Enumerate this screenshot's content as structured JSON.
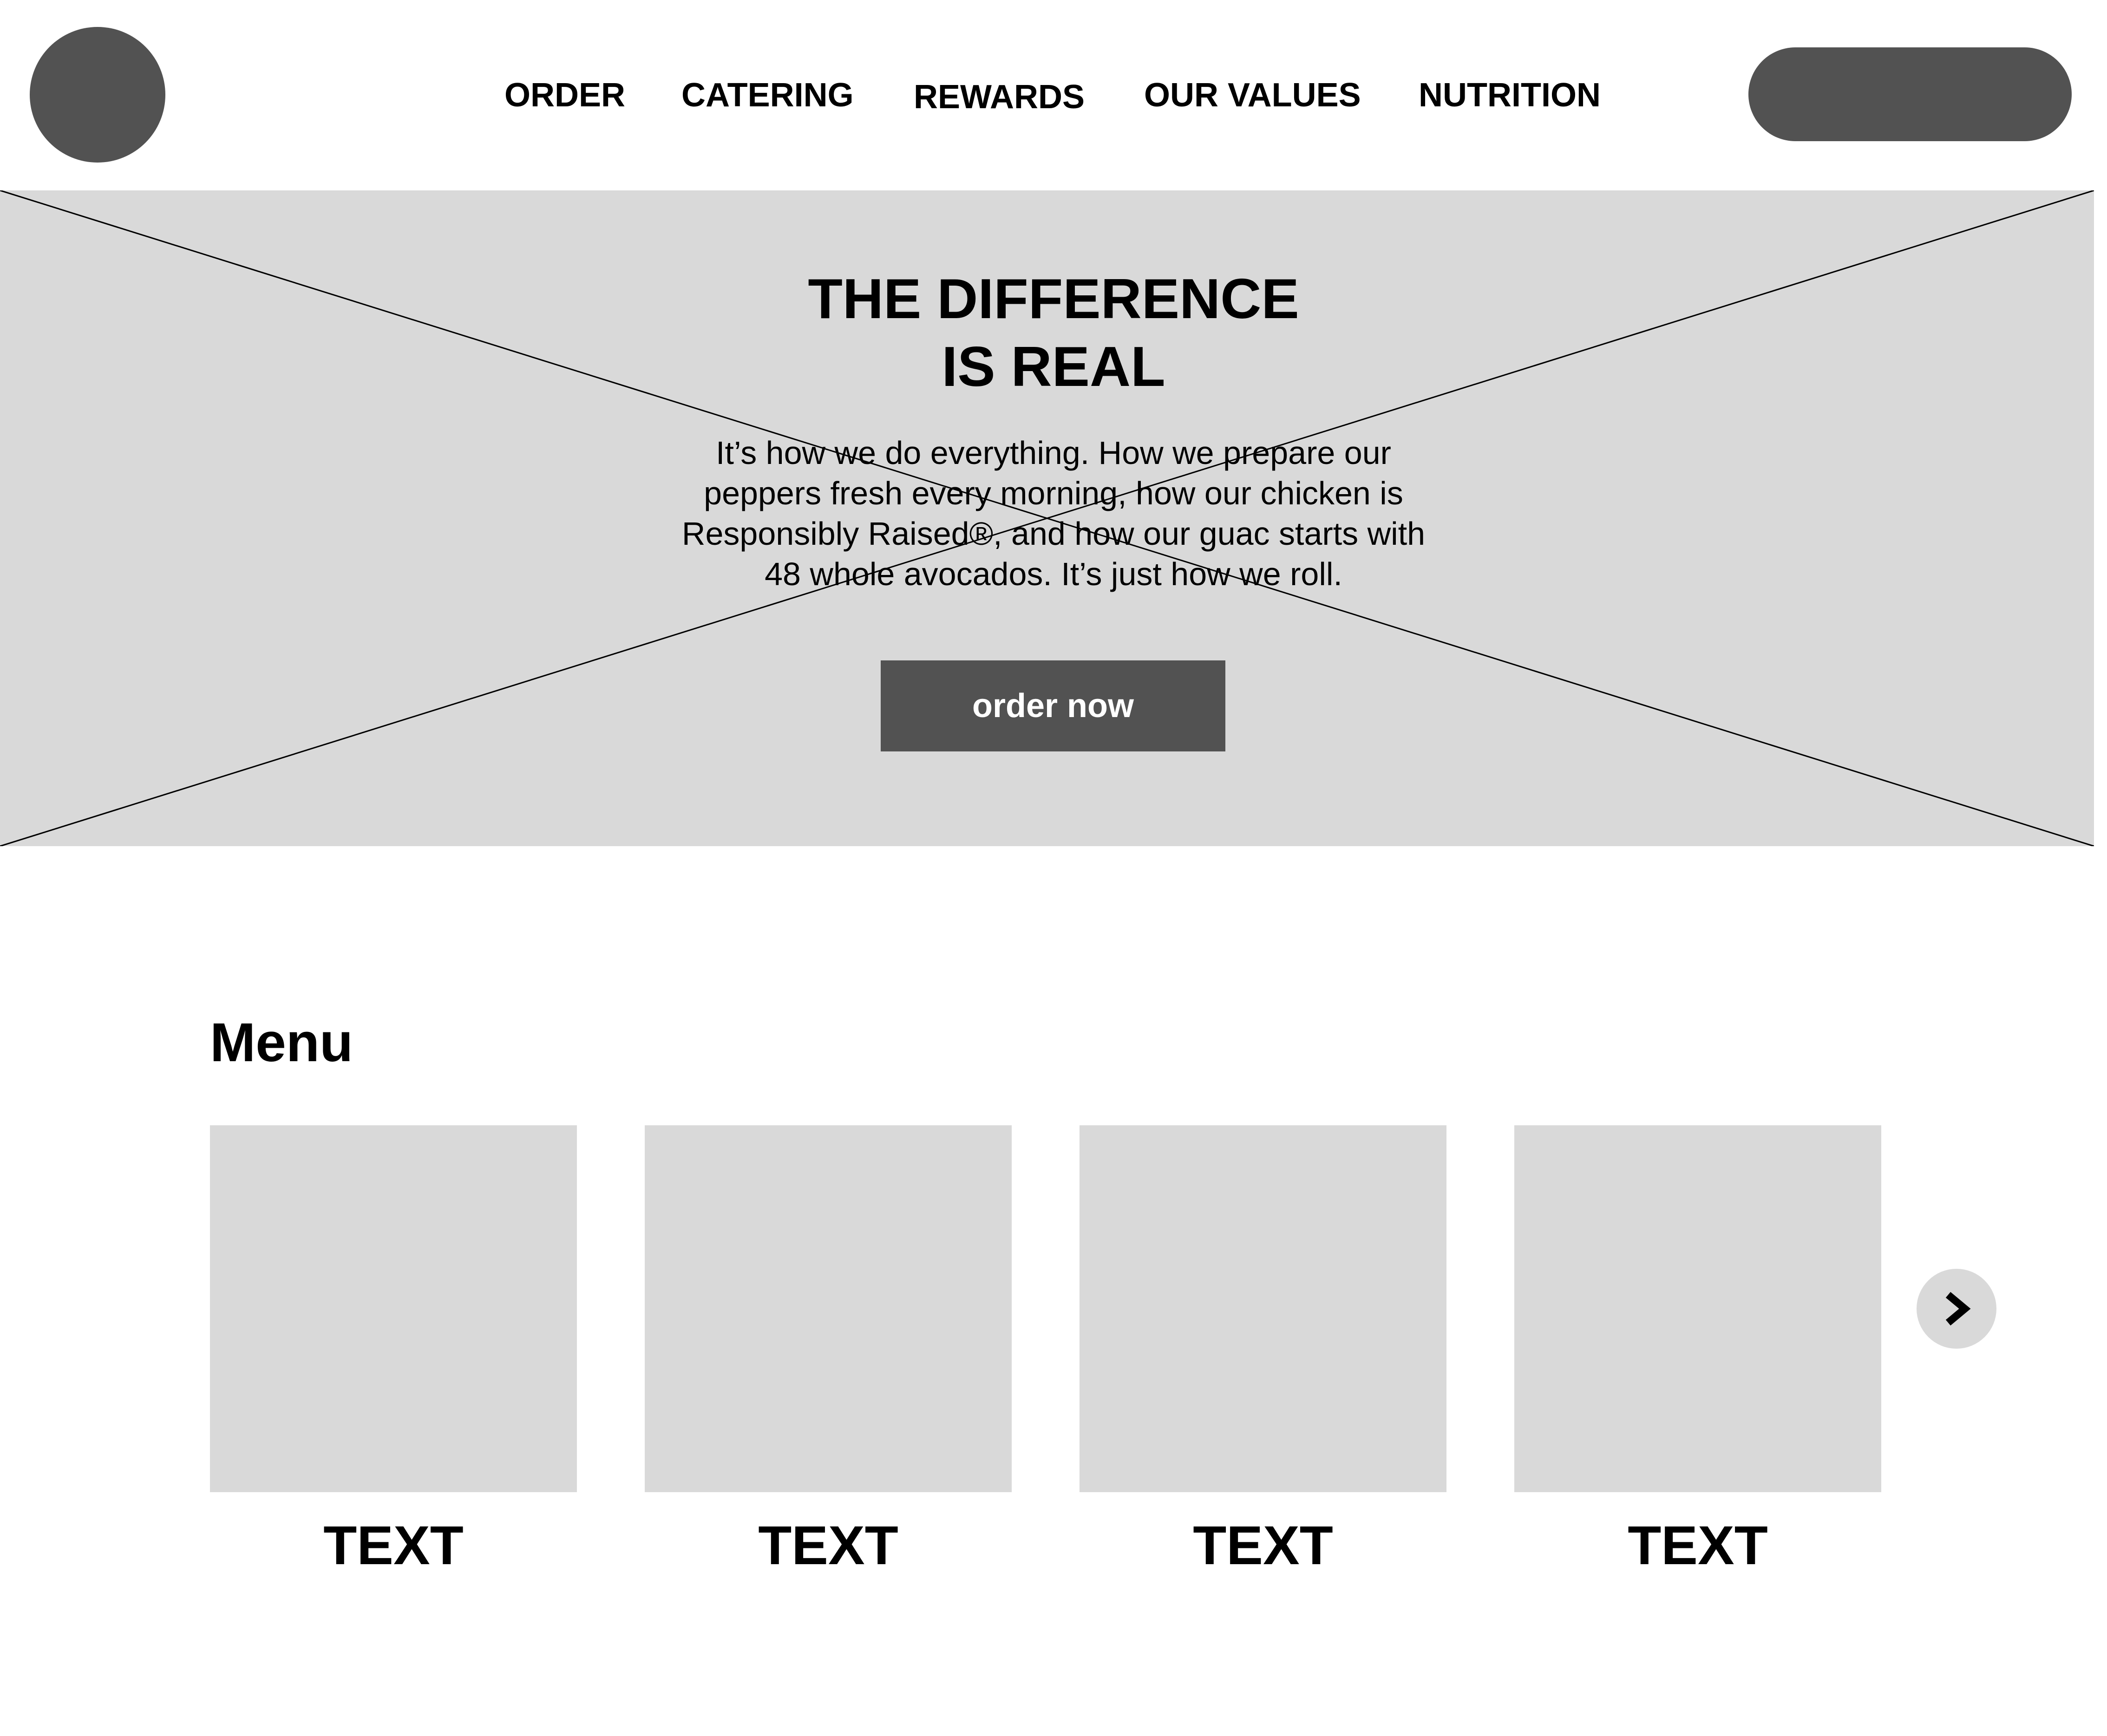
{
  "colors": {
    "placeholder_dark": "#525252",
    "placeholder_light": "#d9d9d9",
    "text": "#000000",
    "button_text": "#ffffff"
  },
  "header": {
    "logo_icon": "logo-placeholder-circle",
    "nav": [
      {
        "label": "ORDER"
      },
      {
        "label": "CATERING"
      },
      {
        "label": "REWARDS"
      },
      {
        "label": "OUR VALUES"
      },
      {
        "label": "NUTRITION"
      }
    ]
  },
  "hero": {
    "image_placeholder": "crossed-out-image-placeholder",
    "title_lines": [
      "THE DIFFERENCE",
      "IS REAL"
    ],
    "body_lines": [
      "It’s how we do everything. How we prepare our",
      "peppers fresh every morning, how our chicken is",
      "Responsibly Raised®, and how our guac starts with",
      "48 whole avocados. It’s just how we roll."
    ],
    "cta_label": "order now"
  },
  "menu": {
    "heading": "Menu",
    "items": [
      {
        "label": "TEXT"
      },
      {
        "label": "TEXT"
      },
      {
        "label": "TEXT"
      },
      {
        "label": "TEXT"
      }
    ],
    "next_icon": "chevron-right-icon"
  }
}
